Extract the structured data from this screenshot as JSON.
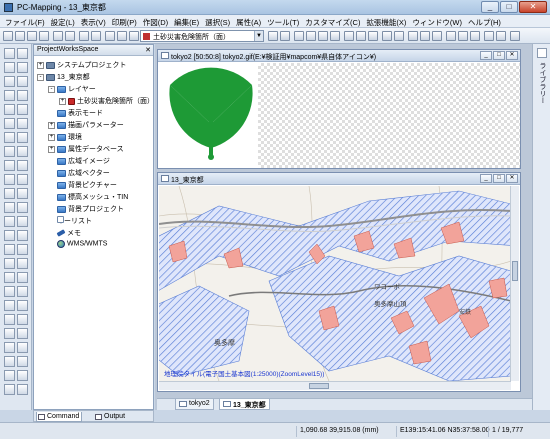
{
  "window": {
    "title": "PC-Mapping - 13_東京都"
  },
  "menu": [
    "ファイル(F)",
    "設定(L)",
    "表示(V)",
    "印刷(P)",
    "作図(D)",
    "編集(E)",
    "選択(S)",
    "属性(A)",
    "ツール(T)",
    "カスタマイズ(C)",
    "拡張機能(X)",
    "ウィンドウ(W)",
    "ヘルプ(H)"
  ],
  "toolbar": {
    "layer_select": "土砂災害危険箇所（面）"
  },
  "project_workspace": {
    "title": "ProjectWorksSpace",
    "nodes": [
      {
        "label": "システムプロジェクト",
        "expander": "+"
      },
      {
        "label": "13_東京都",
        "expander": "-"
      },
      {
        "label": "レイヤー",
        "expander": "-"
      },
      {
        "label": "土砂災害危険箇所（面）",
        "expander": "+"
      },
      {
        "label": "表示モード",
        "expander": ""
      },
      {
        "label": "描画パラメーター",
        "expander": "+"
      },
      {
        "label": "環境",
        "expander": "+"
      },
      {
        "label": "属性データベース",
        "expander": "+"
      },
      {
        "label": "広域イメージ",
        "expander": ""
      },
      {
        "label": "広域ベクター",
        "expander": ""
      },
      {
        "label": "背景ピクチャー",
        "expander": ""
      },
      {
        "label": "標高メッシュ・TIN",
        "expander": ""
      },
      {
        "label": "背景プロジェクト",
        "expander": ""
      },
      {
        "label": "キーリスト",
        "expander": ""
      },
      {
        "label": "メモ",
        "expander": ""
      },
      {
        "label": "WMS/WMTS",
        "expander": ""
      }
    ],
    "tabs": [
      "Command",
      "Output"
    ]
  },
  "image_window": {
    "title": "tokyo2 [50:50:8] tokyo2.gif(E:¥検証用¥mapcom¥県自体アイコン¥)"
  },
  "map_window": {
    "title": "13_東京都",
    "credit": "地理院タイル(電子国土基本図(1:25000)(ZoomLevel15))",
    "labels": [
      "奥多摩",
      "ワコーポ",
      "奥多摩山頂",
      "安鉄"
    ]
  },
  "doc_tabs": [
    "tokyo2",
    "13_東京都"
  ],
  "right_panel": {
    "label": "ライブラリー"
  },
  "status": {
    "coords": "1,090.68 39,915.08 (mm)",
    "latlon": "E139:15:41.06 N35:37:58.00",
    "page": "1 / 19,777"
  },
  "colors": {
    "ginkgo": "#1e9a36",
    "hazard": "#f2a39a",
    "hatch": "#5a7fd6"
  }
}
